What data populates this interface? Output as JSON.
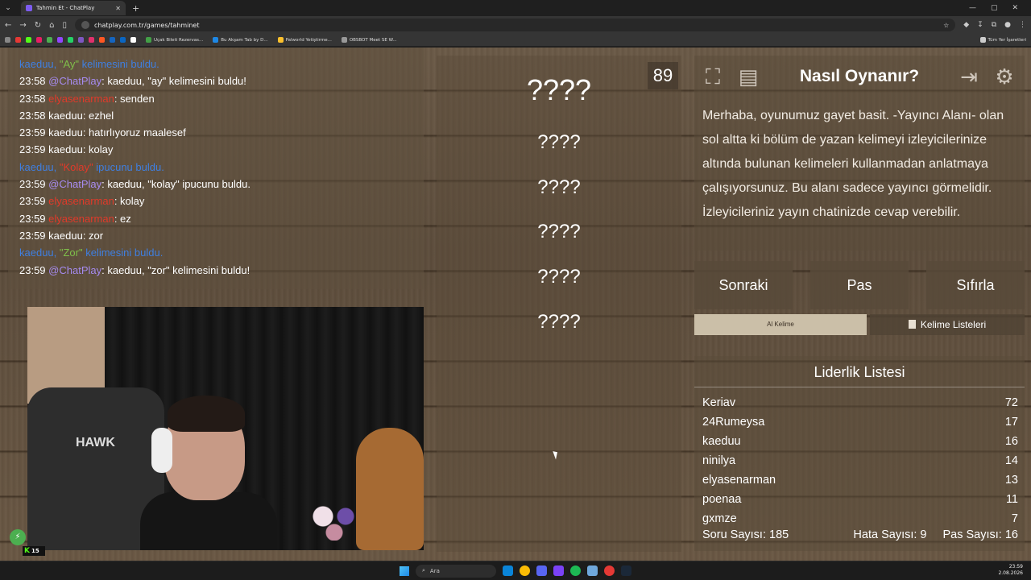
{
  "browser": {
    "tab_title": "Tahmin Et - ChatPlay",
    "url": "chatplay.com.tr/games/tahminet",
    "bookmarks": [
      "Uçak Bileti Rezervas...",
      "Bu Akşam Tab by D...",
      "Palworld Yetiştirme...",
      "OBSBOT Meet SE W..."
    ],
    "all_bookmarks": "Tüm Yer İşaretleri"
  },
  "chat": {
    "lines": [
      {
        "type": "system",
        "prefix": "kaeduu, ",
        "hl": "\"Ay\"",
        "suffix": " kelimesini buldu."
      },
      {
        "time": "23:58",
        "user": "@ChatPlay",
        "color": "cp",
        "msg": ": kaeduu, \"ay\" kelimesini buldu!"
      },
      {
        "time": "23:58",
        "user": "elyasenarman",
        "color": "red",
        "msg": ": senden"
      },
      {
        "time": "23:58",
        "user": "kaeduu",
        "color": "plain",
        "msg": ": ezhel"
      },
      {
        "time": "23:59",
        "user": "kaeduu",
        "color": "plain",
        "msg": ": hatırlıyoruz maalesef"
      },
      {
        "time": "23:59",
        "user": "kaeduu",
        "color": "plain",
        "msg": ": kolay"
      },
      {
        "type": "system",
        "prefix": "kaeduu, ",
        "hl": "\"Kolay\"",
        "hlcolor": "red",
        "suffix": " ipucunu buldu."
      },
      {
        "time": "23:59",
        "user": "@ChatPlay",
        "color": "cp",
        "msg": ": kaeduu, \"kolay\" ipucunu buldu."
      },
      {
        "time": "23:59",
        "user": "elyasenarman",
        "color": "red",
        "msg": ": kolay"
      },
      {
        "time": "23:59",
        "user": "elyasenarman",
        "color": "red",
        "msg": ": ez"
      },
      {
        "time": "23:59",
        "user": "kaeduu",
        "color": "plain",
        "msg": ": zor"
      },
      {
        "type": "system",
        "prefix": "kaeduu, ",
        "hl": "\"Zor\"",
        "suffix": " kelimesini buldu."
      },
      {
        "time": "23:59",
        "user": "@ChatPlay",
        "color": "cp",
        "msg": ": kaeduu, \"zor\" kelimesini buldu!"
      }
    ]
  },
  "stream": {
    "chair_brand": "HAWK",
    "kick_badge_count": "15"
  },
  "game": {
    "timer": "89",
    "main_word": "????",
    "hints": [
      "????",
      "????",
      "????",
      "????",
      "????"
    ]
  },
  "howto": {
    "title": "Nasıl Oynanır?",
    "text": "Merhaba, oyunumuz gayet basit. -Yayıncı Alanı- olan sol altta ki bölüm de yazan kelimeyi izleyicilerinize altında bulunan kelimeleri kullanmadan anlatmaya çalışıyorsunuz. Bu alanı sadece yayıncı görmelidir. İzleyicileriniz yayın chatinizde cevap verebilir."
  },
  "controls": {
    "next": "Sonraki",
    "pass": "Pas",
    "reset": "Sıfırla",
    "words_tab": "Al Kelime",
    "lists_tab": "Kelime Listeleri"
  },
  "leaderboard": {
    "title": "Liderlik Listesi",
    "rows": [
      {
        "name": "Keriav",
        "score": "72"
      },
      {
        "name": "24Rumeysa",
        "score": "17"
      },
      {
        "name": "kaeduu",
        "score": "16"
      },
      {
        "name": "ninilya",
        "score": "14"
      },
      {
        "name": "elyasenarman",
        "score": "13"
      },
      {
        "name": "poenaa",
        "score": "11"
      },
      {
        "name": "gxmze",
        "score": "7"
      }
    ],
    "questions": "Soru Sayısı: 185",
    "errors": "Hata Sayısı: 9",
    "passes": "Pas Sayısı: 16"
  },
  "taskbar": {
    "search_placeholder": "Ara",
    "time": "23:59",
    "date": "2.08.2026"
  }
}
